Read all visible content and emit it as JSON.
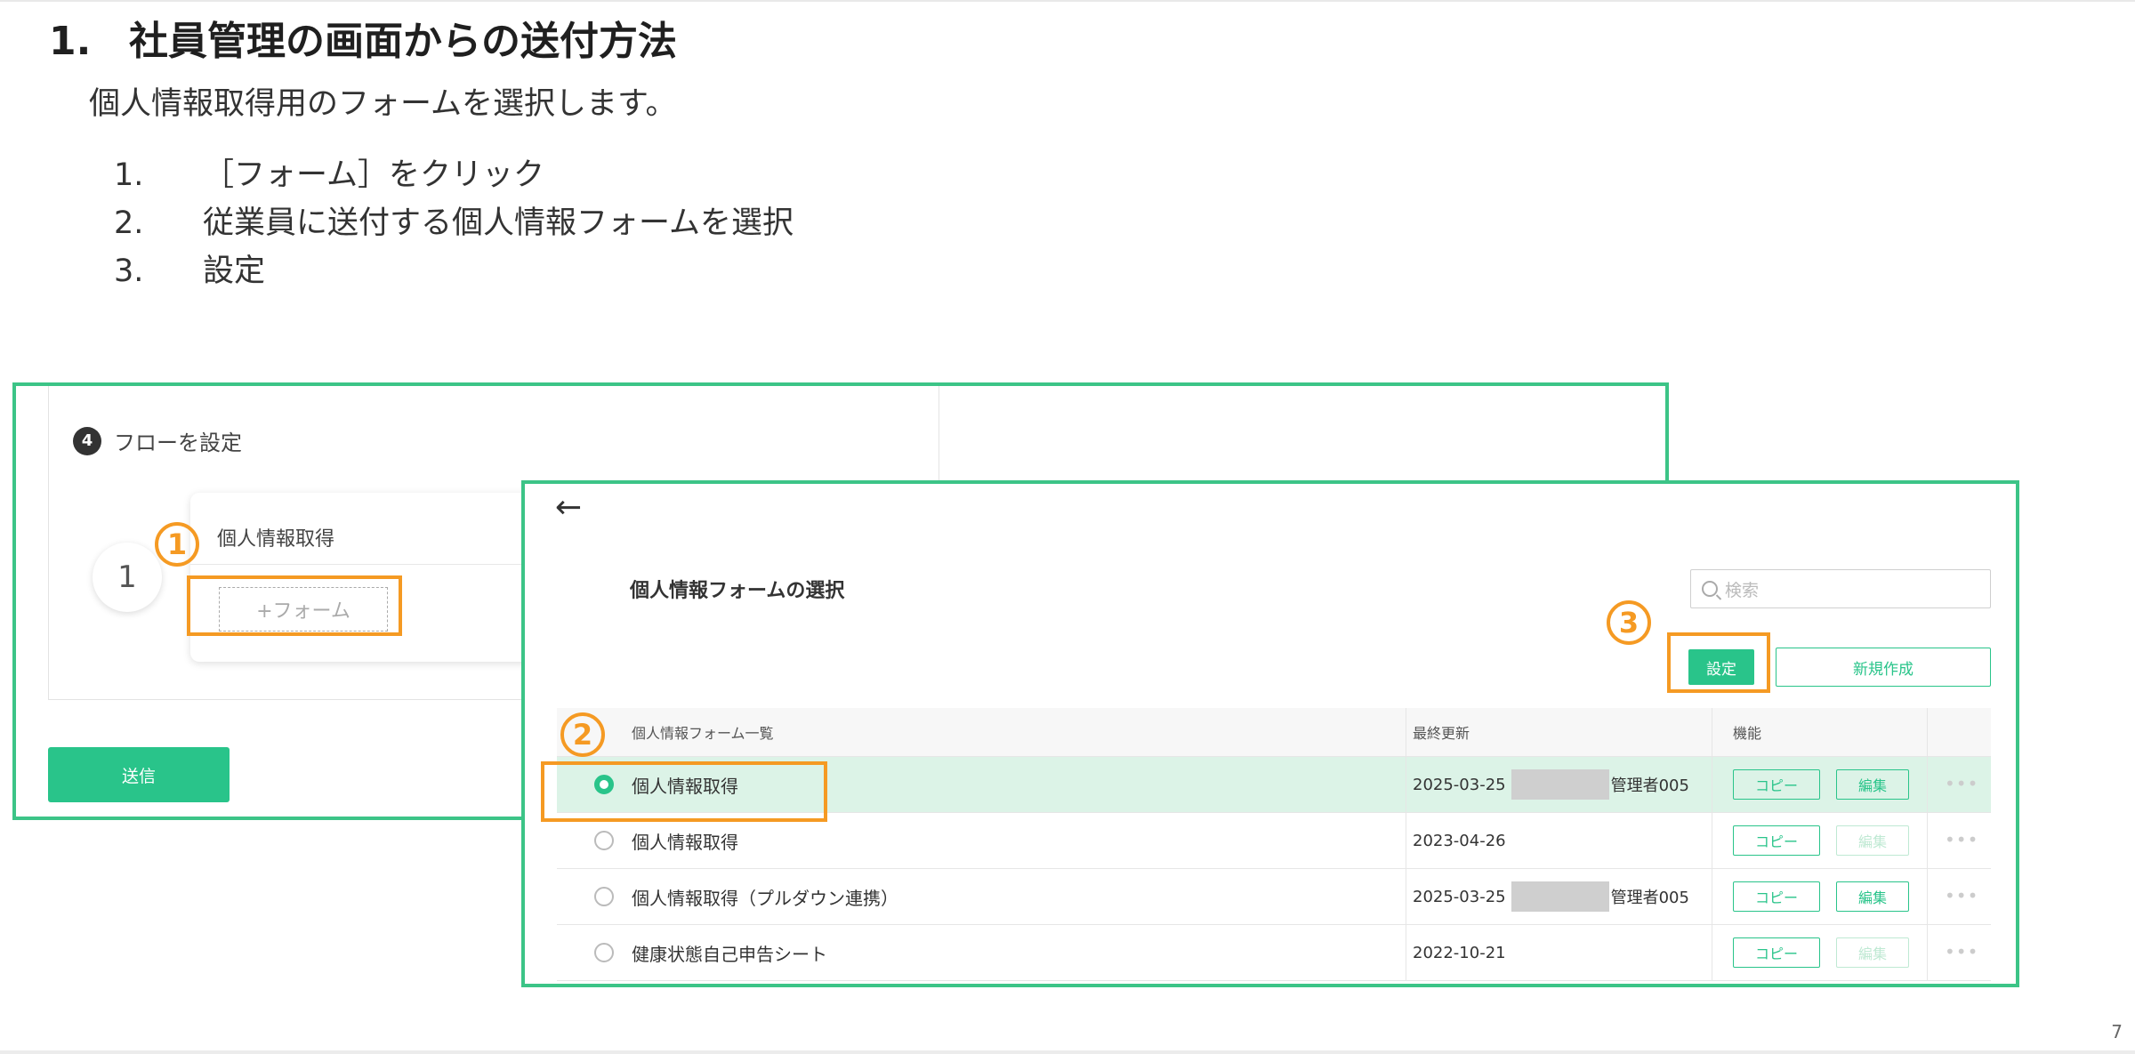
{
  "slide": {
    "title_number": "1.",
    "title": "社員管理の画面からの送付方法",
    "lead": "個人情報取得用のフォームを選択します。",
    "steps": [
      {
        "num": "1.",
        "text": "［フォーム］をクリック"
      },
      {
        "num": "2.",
        "text": "従業員に送付する個人情報フォームを選択"
      },
      {
        "num": "3.",
        "text": "設定"
      }
    ],
    "page_number": "7"
  },
  "screen1": {
    "step_badge": "4",
    "step_label": "フローを設定",
    "flow_index": "1",
    "card_title": "個人情報取得",
    "form_button": "+フォーム",
    "send_button": "送信"
  },
  "screen2": {
    "back_icon": "←",
    "title": "個人情報フォームの選択",
    "search_placeholder": "検索",
    "set_button": "設定",
    "new_button": "新規作成",
    "headers": {
      "name": "個人情報フォーム一覧",
      "date": "最終更新",
      "func": "機能"
    },
    "rows": [
      {
        "name": "個人情報取得",
        "date": "2025-03-25",
        "user": "管理者005",
        "selected": true,
        "edit_enabled": true
      },
      {
        "name": "個人情報取得",
        "date": "2023-04-26",
        "user": "",
        "selected": false,
        "edit_enabled": false
      },
      {
        "name": "個人情報取得（プルダウン連携）",
        "date": "2025-03-25",
        "user": "管理者005",
        "selected": false,
        "edit_enabled": true
      },
      {
        "name": "健康状態自己申告シート",
        "date": "2022-10-21",
        "user": "",
        "selected": false,
        "edit_enabled": false
      }
    ],
    "copy_label": "コピー",
    "edit_label": "編集",
    "more_label": "•••"
  },
  "annotations": {
    "m1": "1",
    "m2": "2",
    "m3": "3"
  },
  "colors": {
    "accent": "#29c48a",
    "frame": "#3cc487",
    "highlight": "#f59a23"
  }
}
